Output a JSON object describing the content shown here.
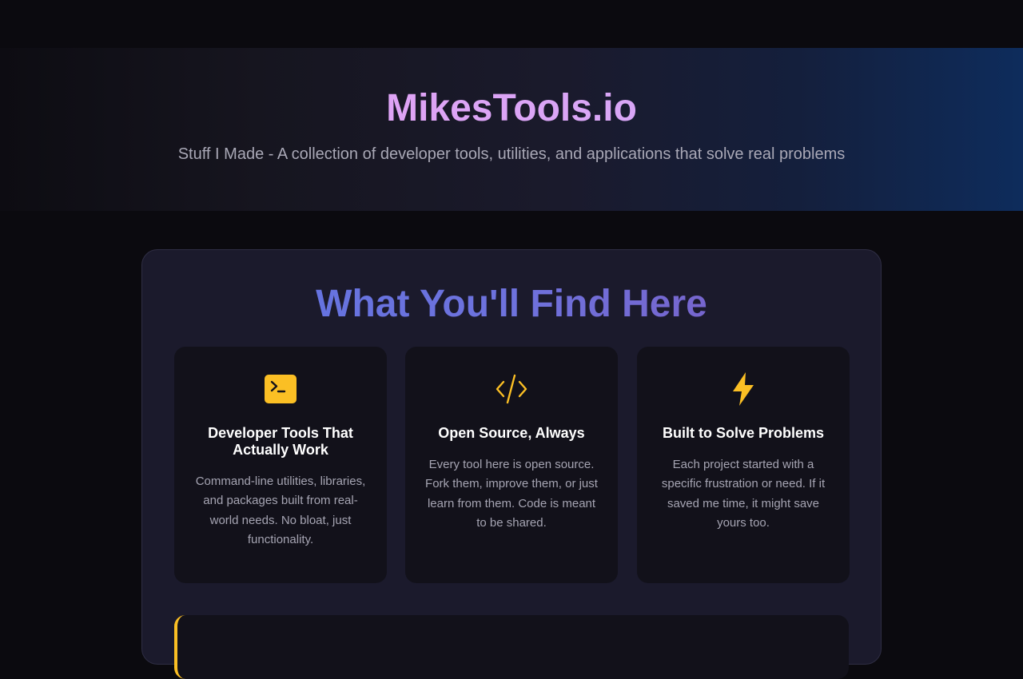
{
  "hero": {
    "title": "MikesTools.io",
    "subtitle": "Stuff I Made - A collection of developer tools, utilities, and applications that solve real problems"
  },
  "features": {
    "heading": "What You'll Find Here",
    "accent_color": "#fbbf24",
    "cards": [
      {
        "icon": "terminal-icon",
        "title": "Developer Tools That Actually Work",
        "text": "Command-line utilities, libraries, and packages built from real-world needs. No bloat, just functionality."
      },
      {
        "icon": "code-icon",
        "title": "Open Source, Always",
        "text": "Every tool here is open source. Fork them, improve them, or just learn from them. Code is meant to be shared."
      },
      {
        "icon": "lightning-bolt-icon",
        "title": "Built to Solve Problems",
        "text": "Each project started with a specific frustration or need. If it saved me time, it might save yours too."
      }
    ]
  }
}
